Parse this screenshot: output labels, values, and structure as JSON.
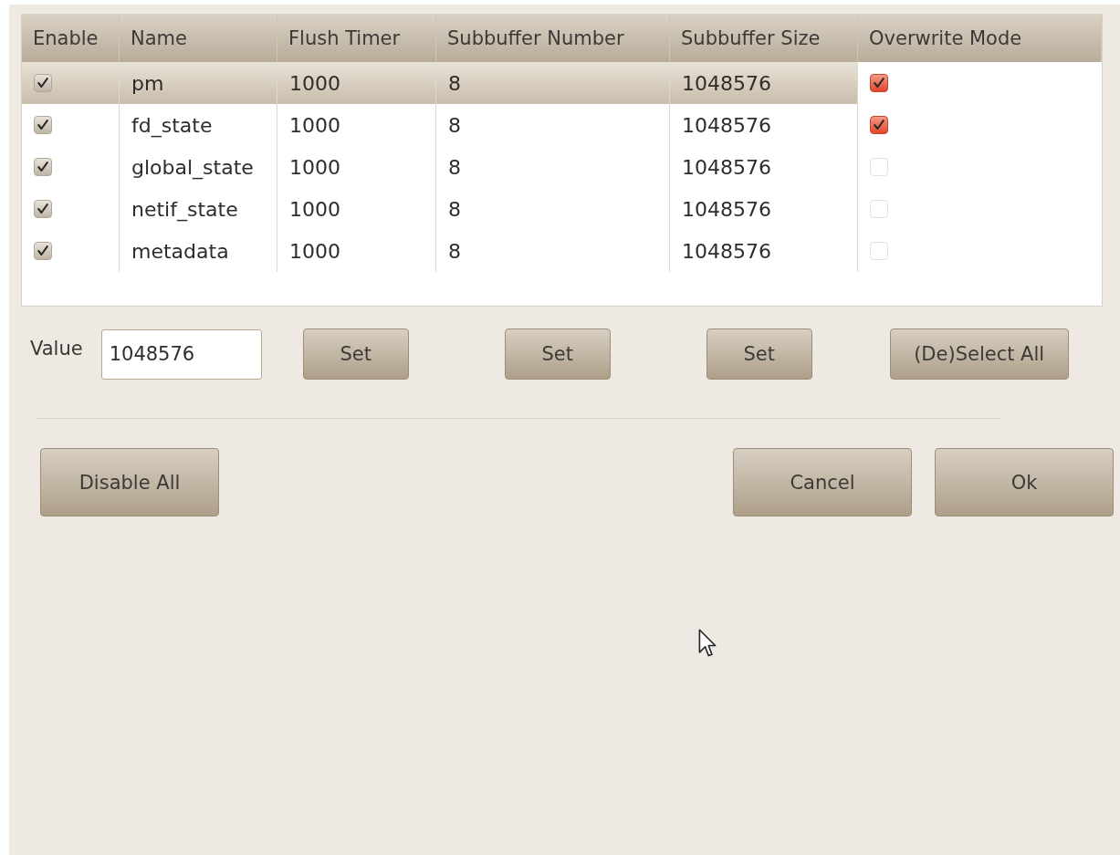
{
  "table": {
    "columns": [
      "Enable",
      "Name",
      "Flush Timer",
      "Subbuffer Number",
      "Subbuffer Size",
      "Overwrite Mode"
    ],
    "rows": [
      {
        "enabled": true,
        "name": "pm",
        "flush_timer": "1000",
        "subbuffer_number": "8",
        "subbuffer_size": "1048576",
        "overwrite": true,
        "selected": true
      },
      {
        "enabled": true,
        "name": "fd_state",
        "flush_timer": "1000",
        "subbuffer_number": "8",
        "subbuffer_size": "1048576",
        "overwrite": true,
        "selected": false
      },
      {
        "enabled": true,
        "name": "global_state",
        "flush_timer": "1000",
        "subbuffer_number": "8",
        "subbuffer_size": "1048576",
        "overwrite": false,
        "selected": false
      },
      {
        "enabled": true,
        "name": "netif_state",
        "flush_timer": "1000",
        "subbuffer_number": "8",
        "subbuffer_size": "1048576",
        "overwrite": false,
        "selected": false
      },
      {
        "enabled": true,
        "name": "metadata",
        "flush_timer": "1000",
        "subbuffer_number": "8",
        "subbuffer_size": "1048576",
        "overwrite": false,
        "selected": false
      }
    ]
  },
  "value_label": "Value",
  "value_field": "1048576",
  "set_buttons": [
    "Set",
    "Set",
    "Set"
  ],
  "select_all_button": "(De)Select All",
  "disable_all_button": "Disable All",
  "cancel_button": "Cancel",
  "ok_button": "Ok"
}
